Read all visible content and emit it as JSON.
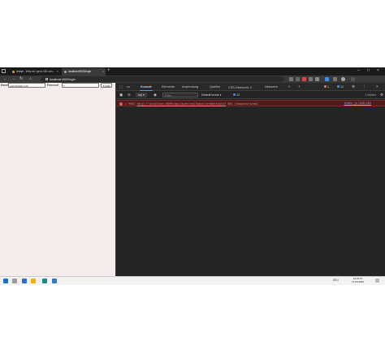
{
  "browser": {
    "tabs": [
      {
        "title": "reduje - Why do I get a 401 con…",
        "active": false
      },
      {
        "title": "localhost:8000/login",
        "active": true
      }
    ],
    "new_tab": "+",
    "url": "localhost:4000/login"
  },
  "page": {
    "email_label": "Email",
    "email_value": "user@gmail.com",
    "password_label": "Password",
    "password_value": "••",
    "login_button": "Login"
  },
  "devtools": {
    "tabs": [
      "Konsole",
      "Elemente",
      "Anwendung",
      "Quellen",
      "CSS-Übersicht ⚠",
      "Netzwerk"
    ],
    "active_tab": "Konsole",
    "errors_count": "1",
    "issues_count": "12",
    "context": "top",
    "filter_placeholder": "Filter",
    "levels": "Default levels",
    "issues_badge": "12",
    "hidden": "1 hidden",
    "console_error": {
      "method": "POST",
      "url": "http://localhost:8000/api/auth/callback/credentials?",
      "status": "401 (Unauthorized)",
      "source": "index.js:136:181"
    },
    "prompt": "›",
    "drawer_tabs": [
      "Konsole",
      "Probleme"
    ],
    "drawer_add": "+"
  },
  "taskbar": {
    "lang": "DEU",
    "time": "13:04:07",
    "date": "17.03.2023"
  },
  "colors": {
    "page_bg": "#f5ecec",
    "devtools_bg": "#242424",
    "error_bg": "#4e1b1b",
    "error_text": "#f28b82",
    "accent": "#4a9cf5"
  }
}
